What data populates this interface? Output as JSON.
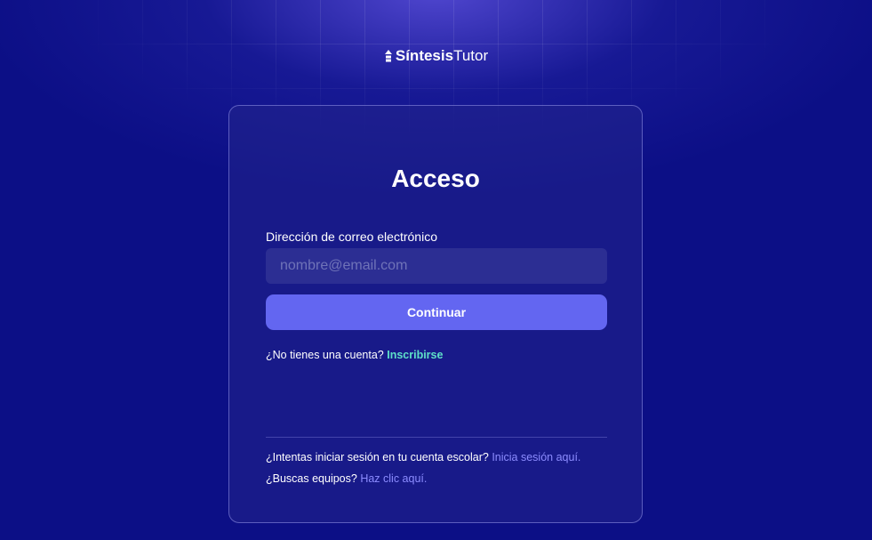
{
  "brand": {
    "name_bold": "Síntesis",
    "name_light": "Tutor",
    "icon": "rocket-icon"
  },
  "login": {
    "title": "Acceso",
    "email_label": "Dirección de correo electrónico",
    "email_placeholder": "nombre@email.com",
    "email_value": "",
    "continue_label": "Continuar",
    "signup_prompt": "¿No tienes una cuenta?",
    "signup_link": "Inscribirse",
    "school_prompt": "¿Intentas iniciar sesión en tu cuenta escolar?",
    "school_link": "Inicia sesión aquí.",
    "teams_prompt": "¿Buscas equipos?",
    "teams_link": "Haz clic aquí."
  },
  "colors": {
    "background": "#0c0f86",
    "button": "#6366f1",
    "signup_link": "#5ee0c8",
    "secondary_link": "#8c8cff"
  }
}
